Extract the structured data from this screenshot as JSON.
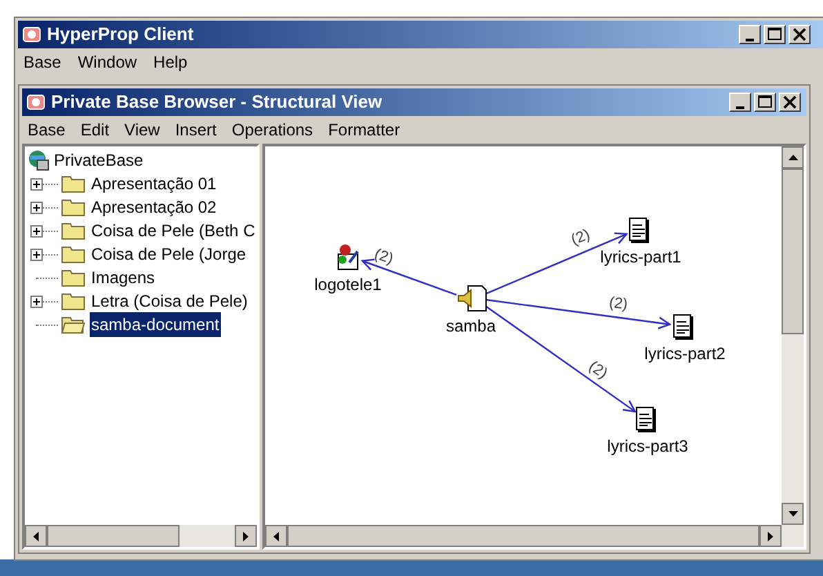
{
  "app_window": {
    "title": "HyperProp Client",
    "menu": [
      "Base",
      "Window",
      "Help"
    ]
  },
  "browser_window": {
    "title": "Private Base Browser - Structural View",
    "menu": [
      "Base",
      "Edit",
      "View",
      "Insert",
      "Operations",
      "Formatter"
    ]
  },
  "tree": {
    "label": "PrivateBase",
    "children": [
      {
        "label": "Apresentação 01",
        "expandable": true,
        "selected": false
      },
      {
        "label": "Apresentação 02",
        "expandable": true,
        "selected": false
      },
      {
        "label": "Coisa de Pele (Beth C",
        "expandable": true,
        "selected": false
      },
      {
        "label": "Coisa de Pele (Jorge",
        "expandable": true,
        "selected": false
      },
      {
        "label": "Imagens",
        "expandable": false,
        "selected": false
      },
      {
        "label": "Letra (Coisa de Pele)",
        "expandable": true,
        "selected": false
      },
      {
        "label": "samba-document",
        "expandable": false,
        "selected": true
      }
    ]
  },
  "graph": {
    "center": {
      "label": "samba",
      "kind": "audio"
    },
    "linked": [
      {
        "label": "logotele1",
        "kind": "image",
        "link_label": "(2)"
      },
      {
        "label": "lyrics-part1",
        "kind": "text",
        "link_label": "(2)"
      },
      {
        "label": "lyrics-part2",
        "kind": "text",
        "link_label": "(2)"
      },
      {
        "label": "lyrics-part3",
        "kind": "text",
        "link_label": "(2)"
      }
    ]
  }
}
